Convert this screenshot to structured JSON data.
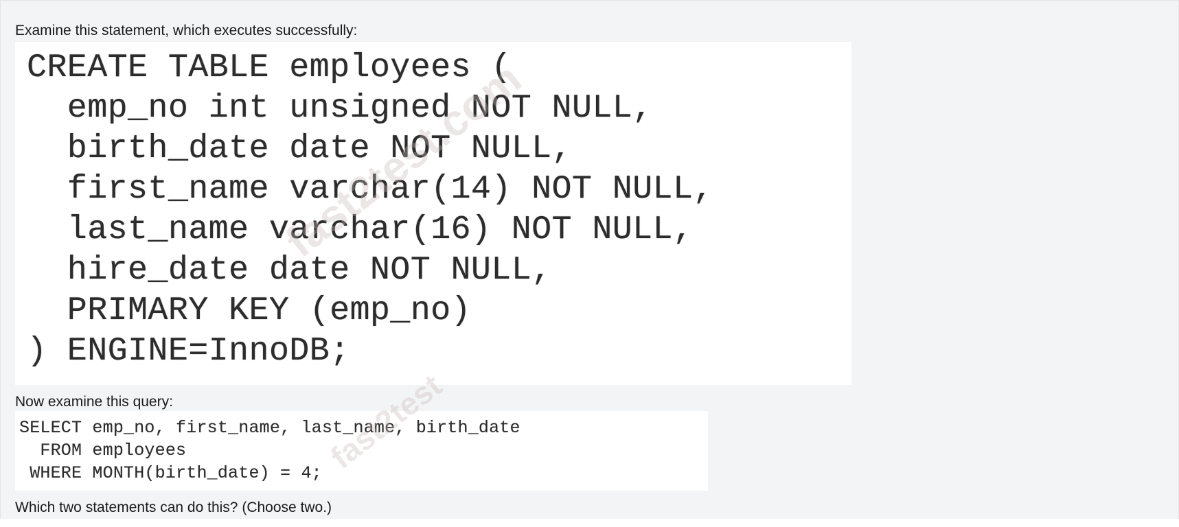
{
  "question": {
    "intro_text": "Examine this statement, which executes successfully:",
    "create_statement": [
      "CREATE TABLE employees (",
      "  emp_no int unsigned NOT NULL,",
      "  birth_date date NOT NULL,",
      "  first_name varchar(14) NOT NULL,",
      "  last_name varchar(16) NOT NULL,",
      "  hire_date date NOT NULL,",
      "  PRIMARY KEY (emp_no)",
      ") ENGINE=InnoDB;"
    ],
    "query_intro_text": "Now examine this query:",
    "query": [
      "SELECT emp_no, first_name, last_name, birth_date",
      "  FROM employees",
      " WHERE MONTH(birth_date) = 4;"
    ],
    "prompt_text": "Which two statements can do this? (Choose two.)"
  },
  "watermarks": [
    "fast2test.com",
    "fast2test"
  ]
}
